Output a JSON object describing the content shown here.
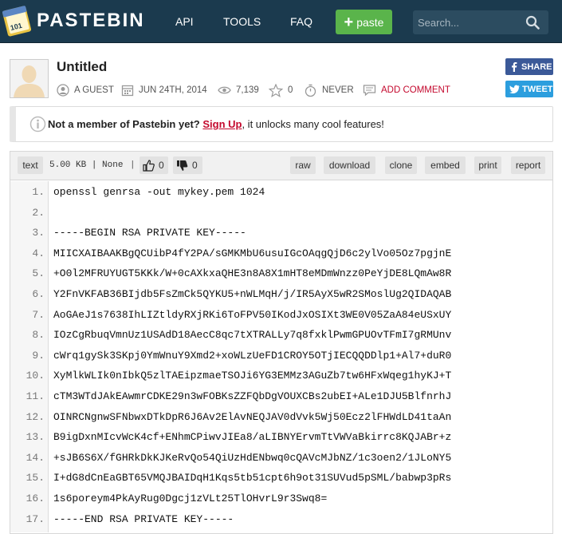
{
  "header": {
    "logo_text": "PASTEBIN",
    "nav": [
      "API",
      "TOOLS",
      "FAQ"
    ],
    "paste_label": "paste",
    "search_placeholder": "Search..."
  },
  "paste": {
    "title": "Untitled",
    "author": "A GUEST",
    "date": "JUN 24TH, 2014",
    "views": "7,139",
    "stars": "0",
    "expiry": "NEVER",
    "add_comment": "ADD COMMENT",
    "share_label": "SHARE",
    "tweet_label": "TWEET"
  },
  "notice": {
    "lead": "Not a member of Pastebin yet?",
    "link": "Sign Up",
    "tail": ", it unlocks many cool features!"
  },
  "toolbar": {
    "format": "text",
    "size": "5.00 KB",
    "syntax": "None",
    "likes": "0",
    "dislikes": "0",
    "actions": [
      "raw",
      "download",
      "clone",
      "embed",
      "print",
      "report"
    ]
  },
  "code_lines": [
    {
      "n": "1.",
      "text": "openssl genrsa -out mykey.pem 1024"
    },
    {
      "n": "2.",
      "text": ""
    },
    {
      "n": "3.",
      "text": "-----BEGIN RSA PRIVATE KEY-----"
    },
    {
      "n": "4.",
      "text": "MIICXAIBAAKBgQCUibP4fY2PA/sGMKMbU6usuIGcOAqgQjD6c2ylVo05Oz7pgjnE"
    },
    {
      "n": "5.",
      "text": "+O0l2MFRUYUGT5KKk/W+0cAXkxaQHE3n8A8X1mHT8eMDmWnzz0PeYjDE8LQmAw8R"
    },
    {
      "n": "6.",
      "text": "Y2FnVKFAB36BIjdb5FsZmCk5QYKU5+nWLMqH/j/IR5AyX5wR2SMoslUg2QIDAQAB"
    },
    {
      "n": "7.",
      "text": "AoGAeJ1s7638IhLIZtldyRXjRKi6ToFPV50IKodJxOSIXt3WE0V05ZaA84eUSxUY"
    },
    {
      "n": "8.",
      "text": "IOzCgRbuqVmnUz1USAdD18AecC8qc7tXTRALLy7q8fxklPwmGPUOvTFmI7gRMUnv"
    },
    {
      "n": "9.",
      "text": "cWrq1gySk3SKpj0YmWnuY9Xmd2+xoWLzUeFD1CROY5OTjIECQQDDlp1+Al7+duR0"
    },
    {
      "n": "10.",
      "text": "XyMlkWLIk0nIbkQ5zlTAEipzmaeTSOJi6YG3EMMz3AGuZb7tw6HFxWqeg1hyKJ+T"
    },
    {
      "n": "11.",
      "text": "cTM3WTdJAkEAwmrCDKE29n3wFOBKsZZFQbDgVOUXCBs2ubEI+ALe1DJU5BlfnrhJ"
    },
    {
      "n": "12.",
      "text": "OINRCNgnwSFNbwxDTkDpR6J6Av2ElAvNEQJAV0dVvk5Wj50Ecz2lFHWdLD41taAn"
    },
    {
      "n": "13.",
      "text": "B9igDxnMIcvWcK4cf+ENhmCPiwvJIEa8/aLIBNYErvmTtVWVaBkirrc8KQJABr+z"
    },
    {
      "n": "14.",
      "text": "+sJB6S6X/fGHRkDkKJKeRvQo54QiUzHdENbwq0cQAVcMJbNZ/1c3oen2/1JLoNY5"
    },
    {
      "n": "15.",
      "text": "I+dG8dCnEaGBT65VMQJBAIDqH1Kqs5tb51cpt6h9ot31SUVud5pSML/babwp3pRs"
    },
    {
      "n": "16.",
      "text": "1s6poreym4PkAyRug0Dgcj1zVLt25TlOHvrL9r3Swq8="
    },
    {
      "n": "17.",
      "text": "-----END RSA PRIVATE KEY-----"
    }
  ]
}
